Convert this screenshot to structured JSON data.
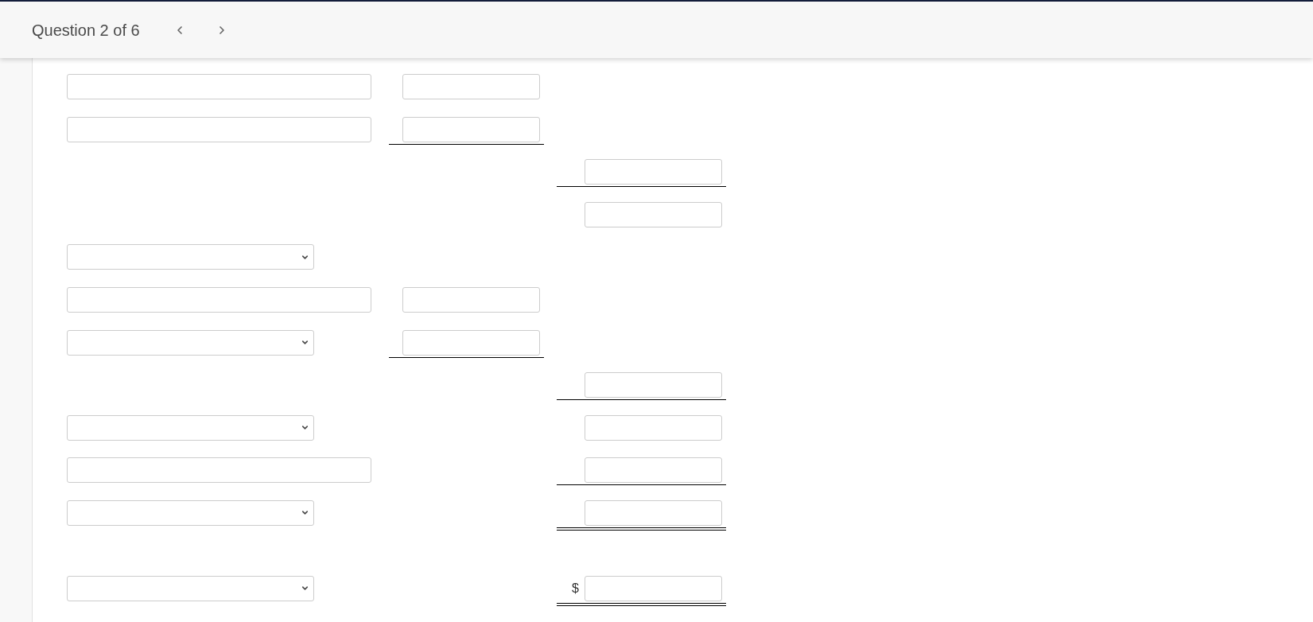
{
  "header": {
    "title": "Question 2 of 6"
  },
  "blocks": [
    {
      "rows": [
        {
          "column_1": {
            "kind": "text_field"
          },
          "column_2": {
            "kind": "text_field"
          }
        },
        {
          "column_1": {
            "kind": "text_field"
          },
          "column_2": {
            "kind": "text_field",
            "rule": {
              "kind": "single"
            }
          }
        },
        {
          "column_3": {
            "kind": "text_field",
            "rule": {
              "kind": "single"
            }
          }
        },
        {
          "column_3": {
            "kind": "text_field"
          }
        },
        {
          "column_1": {
            "kind": "dropdown"
          }
        },
        {
          "column_1": {
            "kind": "text_field"
          },
          "column_2": {
            "kind": "text_field"
          }
        },
        {
          "column_1": {
            "kind": "dropdown"
          },
          "column_2": {
            "kind": "text_field",
            "rule": {
              "kind": "single"
            }
          }
        },
        {
          "column_3": {
            "kind": "text_field",
            "rule": {
              "kind": "single"
            }
          }
        },
        {
          "column_1": {
            "kind": "dropdown"
          },
          "column_3": {
            "kind": "text_field"
          }
        },
        {
          "column_1": {
            "kind": "text_field"
          },
          "column_3": {
            "kind": "text_field",
            "rule": {
              "kind": "single"
            }
          }
        },
        {
          "column_1": {
            "kind": "dropdown"
          },
          "column_3": {
            "kind": "text_field",
            "rule": {
              "kind": "double"
            }
          }
        }
      ]
    },
    {
      "rows": [
        {
          "column_1": {
            "kind": "dropdown"
          },
          "column_3": {
            "kind": "text_field",
            "prefix": "$",
            "rule": {
              "kind": "double"
            }
          }
        }
      ]
    }
  ]
}
